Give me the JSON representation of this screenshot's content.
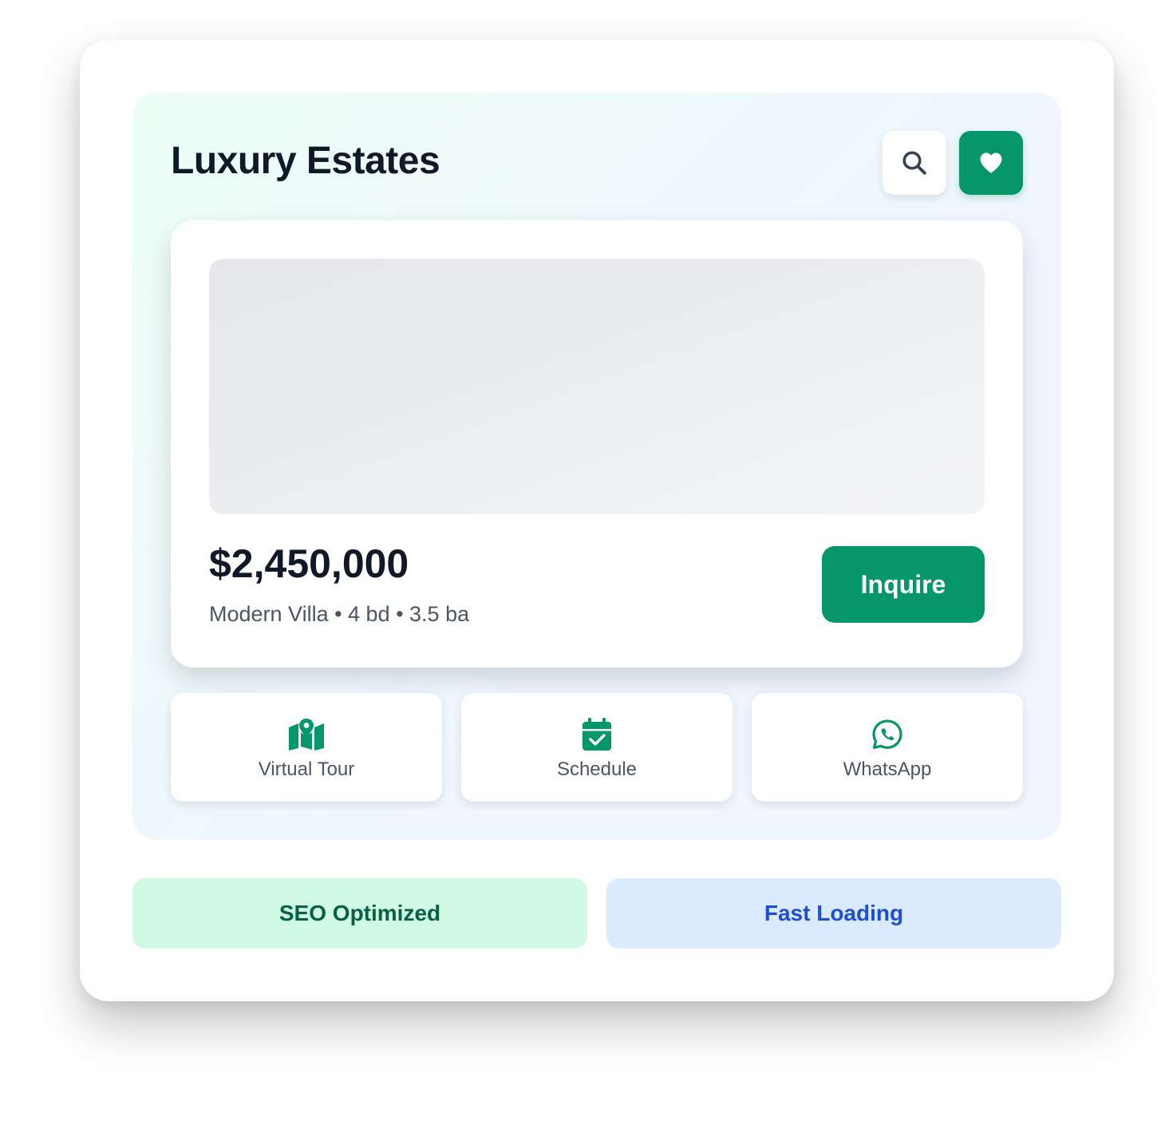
{
  "brand": {
    "title": "Luxury Estates"
  },
  "header_actions": {
    "search_icon": "search-icon",
    "favorite_icon": "heart-icon"
  },
  "listing": {
    "price": "$2,450,000",
    "details": "Modern Villa • 4 bd • 3.5 ba",
    "inquire_label": "Inquire"
  },
  "actions": [
    {
      "label": "Virtual Tour",
      "icon": "map-pin-icon"
    },
    {
      "label": "Schedule",
      "icon": "calendar-check-icon"
    },
    {
      "label": "WhatsApp",
      "icon": "whatsapp-icon"
    }
  ],
  "badges": [
    {
      "label": "SEO Optimized",
      "bg": "#d1fae5",
      "color": "#065f46"
    },
    {
      "label": "Fast Loading",
      "bg": "#dbeafe",
      "color": "#1d4ed8"
    }
  ],
  "colors": {
    "accent": "#059669",
    "text_dark": "#111827",
    "text_muted": "#4b5563"
  }
}
